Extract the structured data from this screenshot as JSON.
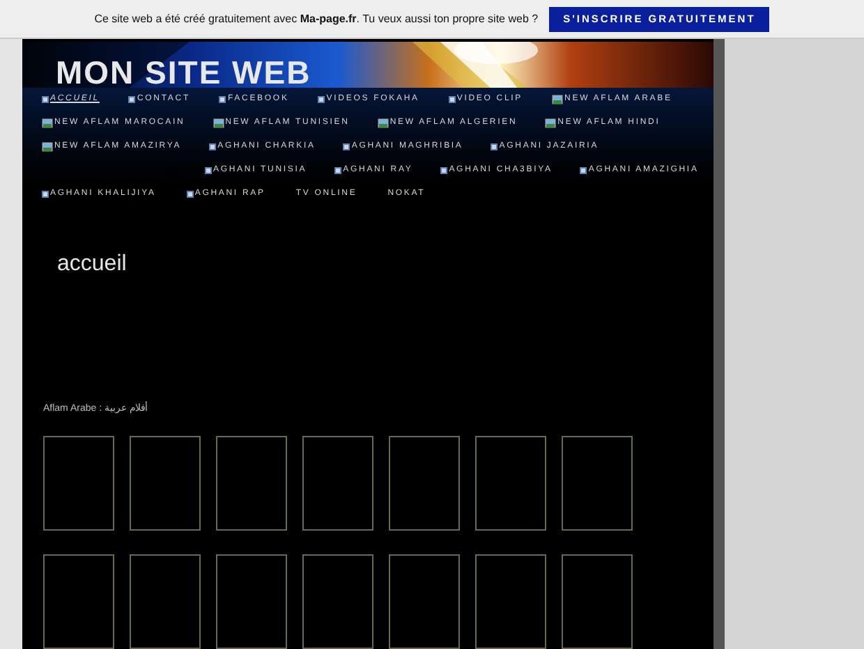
{
  "promo_bar": {
    "text": "Ce site web a été créé gratuitement avec **Ma-page.fr**. Tu veux aussi ton propre site web ?",
    "button": "S'INSCRIRE GRATUITEMENT"
  },
  "header": {
    "title": "MON SITE WEB"
  },
  "menu_rows": [
    [
      {
        "label": "ACCUEIL",
        "kind": "bullet",
        "selected": true
      },
      {
        "label": "CONTACT",
        "kind": "bullet",
        "selected": false
      },
      {
        "label": "FACEBOOK",
        "kind": "bullet",
        "selected": false
      },
      {
        "label": "VIDEOS FOKAHA",
        "kind": "bullet",
        "selected": false
      },
      {
        "label": "VIDEO CLIP",
        "kind": "bullet",
        "selected": false
      },
      {
        "label": "NEW AFLAM ARABE",
        "kind": "broken-image",
        "selected": false
      }
    ],
    [
      {
        "label": "NEW AFLAM MAROCAIN",
        "kind": "broken-image",
        "selected": false
      },
      {
        "label": "NEW AFLAM TUNISIEN",
        "kind": "broken-image",
        "selected": false
      },
      {
        "label": "NEW AFLAM ALGERIEN",
        "kind": "broken-image",
        "selected": false
      },
      {
        "label": "NEW AFLAM HINDI",
        "kind": "broken-image",
        "selected": false
      }
    ],
    [
      {
        "label": "NEW AFLAM AMAZIRYA",
        "kind": "broken-image",
        "selected": false
      },
      {
        "label": "AGHANI CHARKIA",
        "kind": "bullet",
        "selected": false
      },
      {
        "label": "AGHANI MAGHRIBIA",
        "kind": "bullet",
        "selected": false
      },
      {
        "label": "AGHANI JAZAIRIA",
        "kind": "bullet",
        "selected": false
      }
    ],
    [
      {
        "label": "AGHANI TUNISIA",
        "kind": "bullet",
        "selected": false
      },
      {
        "label": "AGHANI RAY",
        "kind": "bullet",
        "selected": false
      },
      {
        "label": "AGHANI CHA3BIYA",
        "kind": "bullet",
        "selected": false
      },
      {
        "label": "AGHANI AMAZIGHIA",
        "kind": "bullet",
        "selected": false
      }
    ],
    [
      {
        "label": "AGHANI KHALIJIYA",
        "kind": "bullet",
        "selected": false
      },
      {
        "label": "AGHANI RAP",
        "kind": "bullet",
        "selected": false
      },
      {
        "label": "TV ONLINE",
        "kind": "plain",
        "selected": false
      },
      {
        "label": "NOKAT",
        "kind": "plain",
        "selected": false
      }
    ]
  ],
  "page_title": "accueil",
  "section_label": "Aflam Arabe : أفلام عربية",
  "thumbnail_rows": [
    [
      {
        "kind": "frame"
      },
      {
        "kind": "frame"
      },
      {
        "kind": "frame"
      },
      {
        "kind": "frame"
      },
      {
        "kind": "frame"
      },
      {
        "kind": "frame"
      },
      {
        "kind": "frame"
      }
    ],
    [
      {
        "kind": "frame"
      },
      {
        "kind": "frame"
      },
      {
        "kind": "frame"
      },
      {
        "kind": "frame"
      },
      {
        "kind": "frame"
      },
      {
        "kind": "frame"
      },
      {
        "kind": "frame"
      }
    ]
  ]
}
